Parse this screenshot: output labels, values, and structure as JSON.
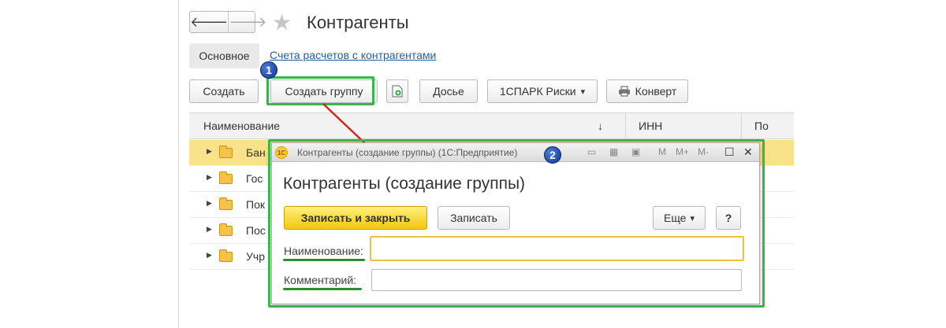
{
  "window": {
    "title": "Контрагенты"
  },
  "nav": {
    "back_icon": "arrow-left-icon",
    "forward_icon": "arrow-right-icon",
    "back_glyph": "🡐",
    "forward_glyph": "🡒",
    "star_glyph": "★"
  },
  "tabs": {
    "main": "Основное",
    "link": "Счета расчетов с контрагентами"
  },
  "toolbar": {
    "create": "Создать",
    "create_group": "Создать группу",
    "dossier": "Досье",
    "spark": "1СПАРК Риски",
    "spark_arrow": "▾",
    "envelope": "Конверт"
  },
  "table": {
    "columns": [
      "Наименование",
      "ИНН",
      "По"
    ],
    "sort_glyph": "↓",
    "rows": [
      "Бан",
      "Гос",
      "Пок",
      "Пос",
      "Учр"
    ]
  },
  "badges": {
    "one": "1",
    "two": "2"
  },
  "dialog": {
    "title": "Контрагенты (создание группы)  (1С:Предприятие)",
    "logo": "1С",
    "heading": "Контрагенты (создание группы)",
    "save_close": "Записать и закрыть",
    "save": "Записать",
    "more": "Еще",
    "more_arrow": "▾",
    "help": "?",
    "name_label": "Наименование:",
    "name_value": "",
    "comment_label": "Комментарий:",
    "comment_value": "",
    "tb_m": "M",
    "tb_mplus": "M+",
    "tb_mminus": "M-",
    "tb_restore": "☐",
    "tb_close": "✕"
  },
  "colors": {
    "highlight": "#39b54a",
    "selected_row": "#f8e28a",
    "primary_button": "#f2c80f",
    "arrow": "#d0281b"
  }
}
